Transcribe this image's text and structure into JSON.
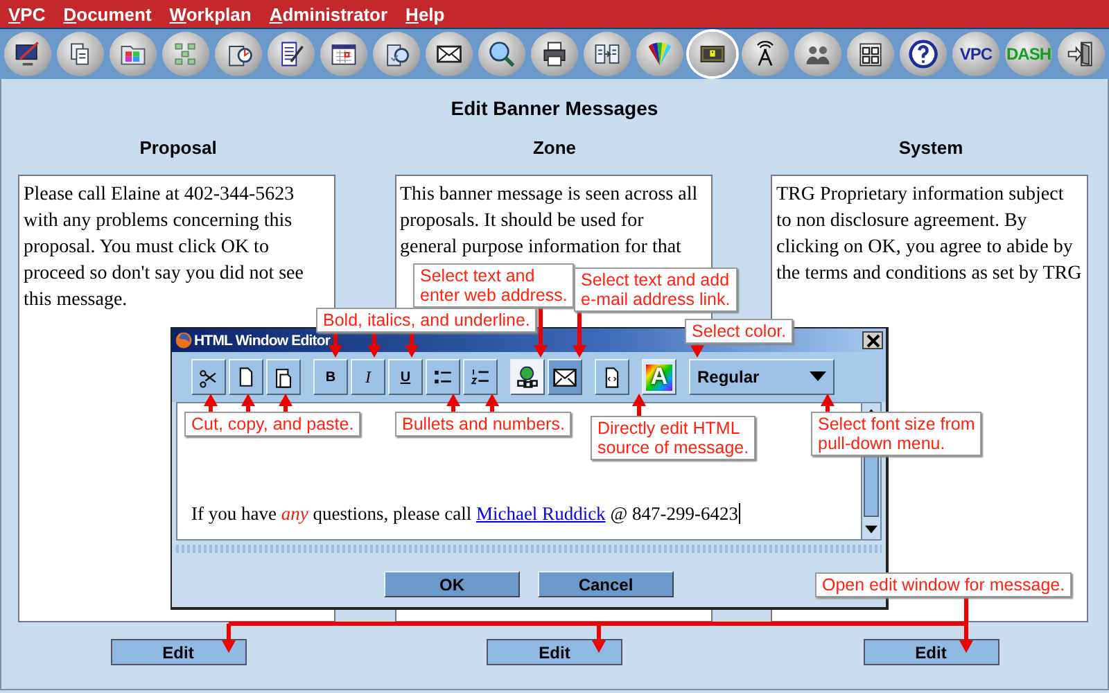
{
  "menu": [
    "VPC",
    "Document",
    "Workplan",
    "Administrator",
    "Help"
  ],
  "toolbar": [
    {
      "kind": "monitor",
      "selected": false
    },
    {
      "kind": "documents",
      "selected": false
    },
    {
      "kind": "folder",
      "selected": false
    },
    {
      "kind": "network",
      "selected": false
    },
    {
      "kind": "clipboard",
      "selected": false
    },
    {
      "kind": "notepad",
      "selected": false
    },
    {
      "kind": "calendar",
      "selected": false
    },
    {
      "kind": "page",
      "selected": false
    },
    {
      "kind": "envelope",
      "selected": false
    },
    {
      "kind": "search",
      "selected": false
    },
    {
      "kind": "printer",
      "selected": false
    },
    {
      "kind": "compare",
      "selected": false
    },
    {
      "kind": "fan",
      "selected": false
    },
    {
      "kind": "screen",
      "selected": true
    },
    {
      "kind": "antenna",
      "selected": false
    },
    {
      "kind": "people",
      "selected": false
    },
    {
      "kind": "grid",
      "selected": false
    },
    {
      "kind": "help",
      "selected": false
    },
    {
      "kind": "text",
      "label": "VPC",
      "color": "#1c2f9c",
      "selected": false
    },
    {
      "kind": "text",
      "label": "DASH",
      "color": "#12a020",
      "selected": false
    },
    {
      "kind": "exit",
      "selected": false
    }
  ],
  "heading": "Edit Banner Messages",
  "panels": [
    {
      "title": "Proposal",
      "lines": [
        "Please call Elaine at 402-344-5623",
        "with any problems concerning this",
        "proposal.  You must click OK to",
        "proceed so don't say you did not see",
        "this message."
      ],
      "button": "Edit"
    },
    {
      "title": "Zone",
      "lines": [
        "This banner message is seen across all",
        "proposals.  It should be used for",
        "general purpose information for that"
      ],
      "button": "Edit"
    },
    {
      "title": "System",
      "lines": [
        "TRG Proprietary information subject",
        "to non disclosure agreement. By",
        "clicking on OK, you agree to abide by",
        "the terms and conditions as set by TRG"
      ],
      "button": "Edit"
    }
  ],
  "dialog": {
    "title": "HTML Window Editor",
    "tool_groups": [
      [
        {
          "kind": "cut"
        },
        {
          "kind": "copy"
        },
        {
          "kind": "paste"
        }
      ],
      [
        {
          "kind": "bold",
          "label": "B"
        },
        {
          "kind": "italic",
          "label": "I"
        },
        {
          "kind": "underline",
          "label": "U"
        },
        {
          "kind": "bullets"
        },
        {
          "kind": "numbers"
        }
      ],
      [
        {
          "kind": "link"
        },
        {
          "kind": "mail"
        }
      ],
      [
        {
          "kind": "source"
        }
      ],
      [
        {
          "kind": "color",
          "label": "A"
        }
      ]
    ],
    "font_select": "Regular",
    "text_before": "If you have *any* questions, please call ",
    "link": "Michael Ruddick",
    "text_after": " @ 847-299-6423",
    "buttons": [
      "OK",
      "Cancel"
    ]
  },
  "callouts": [
    [
      "Select text and",
      "enter web address."
    ],
    [
      "Select text and add",
      "e-mail address link."
    ],
    [
      "Bold, italics, and underline."
    ],
    [
      "Select color."
    ],
    [
      "Cut, copy, and paste."
    ],
    [
      "Bullets and numbers."
    ],
    [
      "Directly edit HTML",
      "source of message."
    ],
    [
      "Select font size from",
      "pull-down menu."
    ],
    [
      "Open edit window for message."
    ]
  ]
}
